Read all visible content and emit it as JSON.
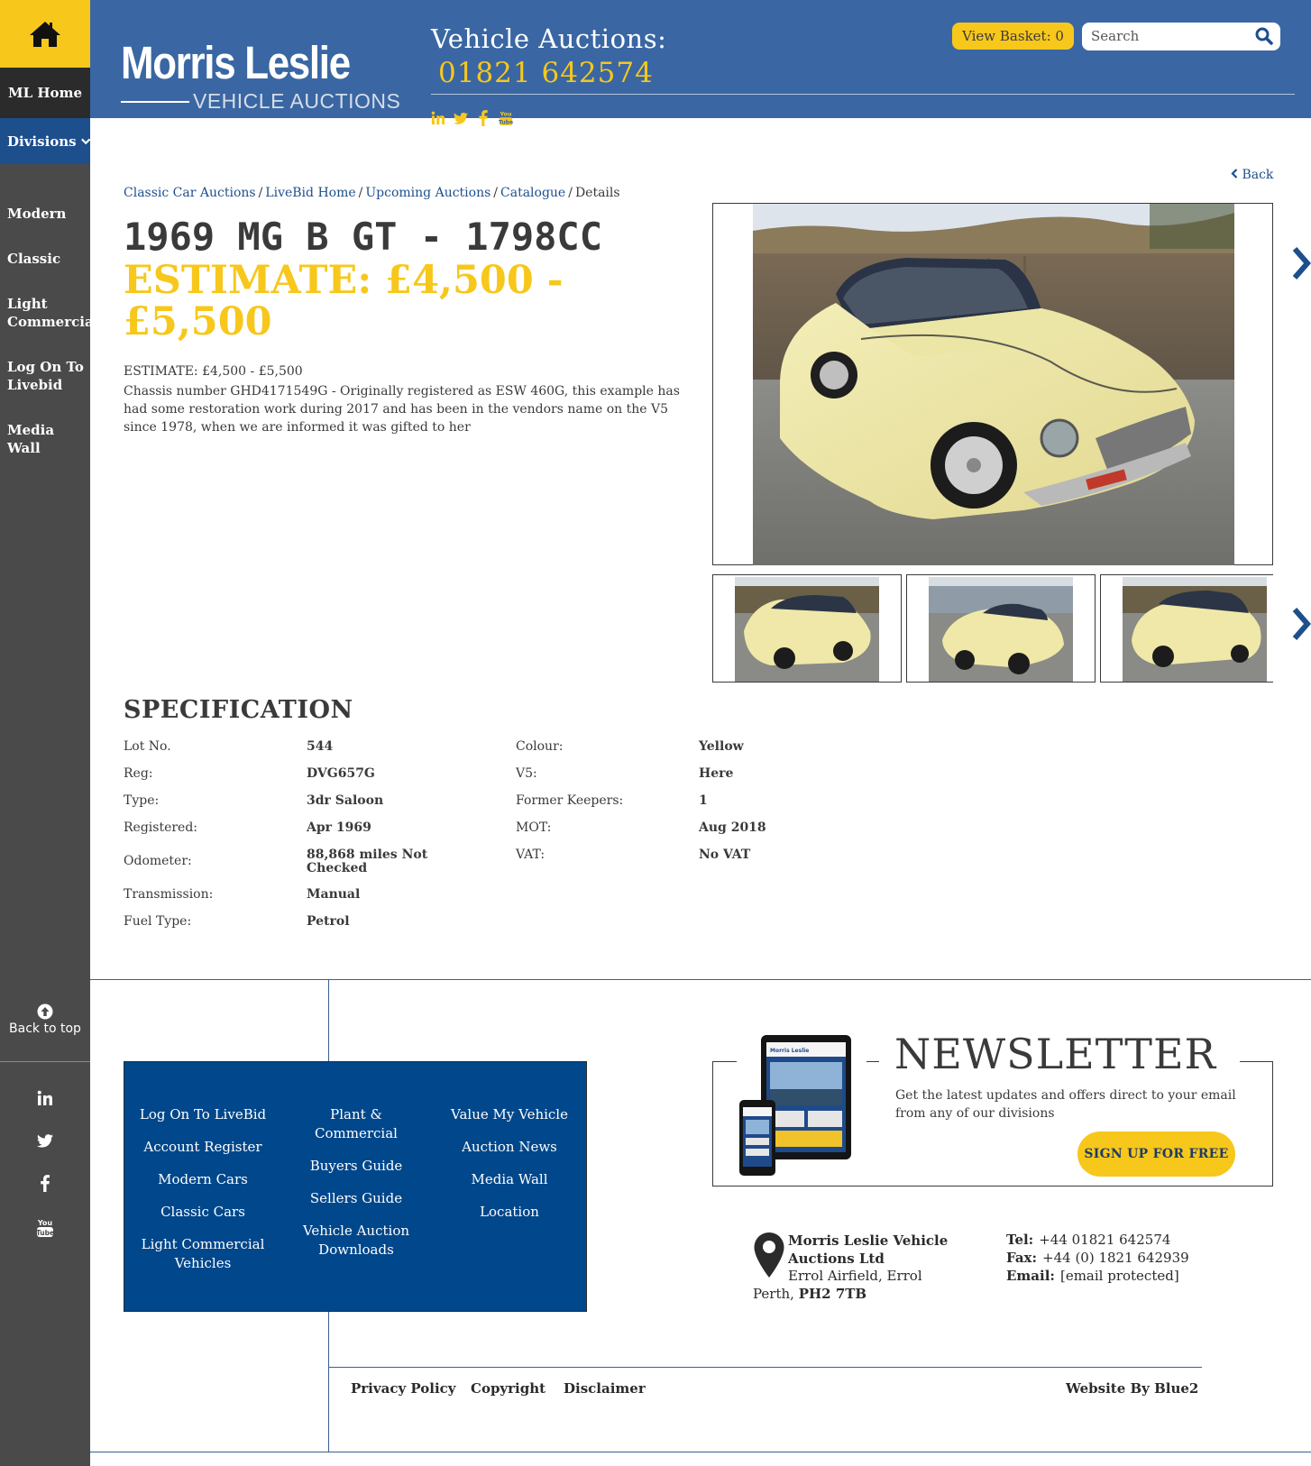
{
  "sidebar": {
    "home_icon": "home-icon",
    "ml_home": "ML Home",
    "divisions": "Divisions",
    "items": [
      {
        "label": "Modern"
      },
      {
        "label": "Classic"
      },
      {
        "label": "Light Commercial"
      },
      {
        "label": "Log On To Livebid"
      },
      {
        "label": "Media Wall"
      }
    ],
    "back_to_top": "Back to top",
    "social_icons": [
      "linkedin-icon",
      "twitter-icon",
      "facebook-icon",
      "youtube-icon"
    ]
  },
  "header": {
    "logo_top": "Morris Leslie",
    "logo_bottom": "VEHICLE AUCTIONS",
    "auctions_label": "Vehicle Auctions:",
    "phone": "01821 642574",
    "basket_label": "View Basket: 0",
    "search_placeholder": "Search",
    "social_icons": [
      "linkedin-icon",
      "twitter-icon",
      "facebook-icon",
      "youtube-icon"
    ]
  },
  "colors": {
    "brand_blue": "#3a67a3",
    "dark_blue": "#00478b",
    "accent_yellow": "#f7c71b",
    "sidebar_grey": "#4a4a4a"
  },
  "main": {
    "back_link": "Back",
    "breadcrumb": [
      {
        "label": "Classic Car Auctions",
        "link": true
      },
      {
        "label": "LiveBid Home",
        "link": true
      },
      {
        "label": "Upcoming Auctions",
        "link": true
      },
      {
        "label": "Catalogue",
        "link": true
      },
      {
        "label": "Details",
        "link": false
      }
    ],
    "title": "1969 MG B GT - 1798CC",
    "estimate_title": "ESTIMATE: £4,500 - £5,500",
    "estimate_small": "ESTIMATE: £4,500 - £5,500",
    "description": "Chassis number GHD4171549G - Originally registered as ESW 460G, this example has had some restoration work during 2017 and has been in the vendors name on the V5 since 1978, when we are informed it was gifted to her"
  },
  "specification": {
    "heading": "SPECIFICATION",
    "left": [
      {
        "label": "Lot No.",
        "value": "544"
      },
      {
        "label": "Reg:",
        "value": "DVG657G"
      },
      {
        "label": "Type:",
        "value": "3dr Saloon"
      },
      {
        "label": "Registered:",
        "value": "Apr 1969"
      },
      {
        "label": "Odometer:",
        "value": "88,868 miles Not Checked"
      },
      {
        "label": "Transmission:",
        "value": "Manual"
      },
      {
        "label": "Fuel Type:",
        "value": "Petrol"
      }
    ],
    "right": [
      {
        "label": "Colour:",
        "value": "Yellow"
      },
      {
        "label": "V5:",
        "value": "Here"
      },
      {
        "label": "Former Keepers:",
        "value": "1"
      },
      {
        "label": "MOT:",
        "value": "Aug 2018"
      },
      {
        "label": "VAT:",
        "value": "No VAT"
      }
    ]
  },
  "footer": {
    "links": [
      [
        "Log On To LiveBid",
        "Account Register",
        "Modern Cars",
        "Classic Cars",
        "Light Commercial Vehicles"
      ],
      [
        "Plant & Commercial",
        "Buyers Guide",
        "Sellers Guide",
        "Vehicle Auction Downloads"
      ],
      [
        "Value My Vehicle",
        "Auction News",
        "Media Wall",
        "Location"
      ]
    ],
    "newsletter": {
      "title": "NEWSLETTER",
      "text": "Get the latest updates and offers direct to your email from any of our divisions",
      "button": "SIGN UP FOR FREE"
    },
    "company": {
      "name": "Morris Leslie Vehicle Auctions Ltd",
      "address1": "Errol Airfield, Errol",
      "address2_town": "Perth,",
      "postcode": "PH2 7TB"
    },
    "contact": {
      "tel_label": "Tel:",
      "tel": "+44 01821 642574",
      "fax_label": "Fax:",
      "fax": "+44 (0) 1821 642939",
      "email_label": "Email:",
      "email": "[email protected]"
    },
    "legal": {
      "privacy": "Privacy Policy",
      "copyright": "Copyright",
      "disclaimer": "Disclaimer",
      "credit": "Website By Blue2"
    }
  }
}
